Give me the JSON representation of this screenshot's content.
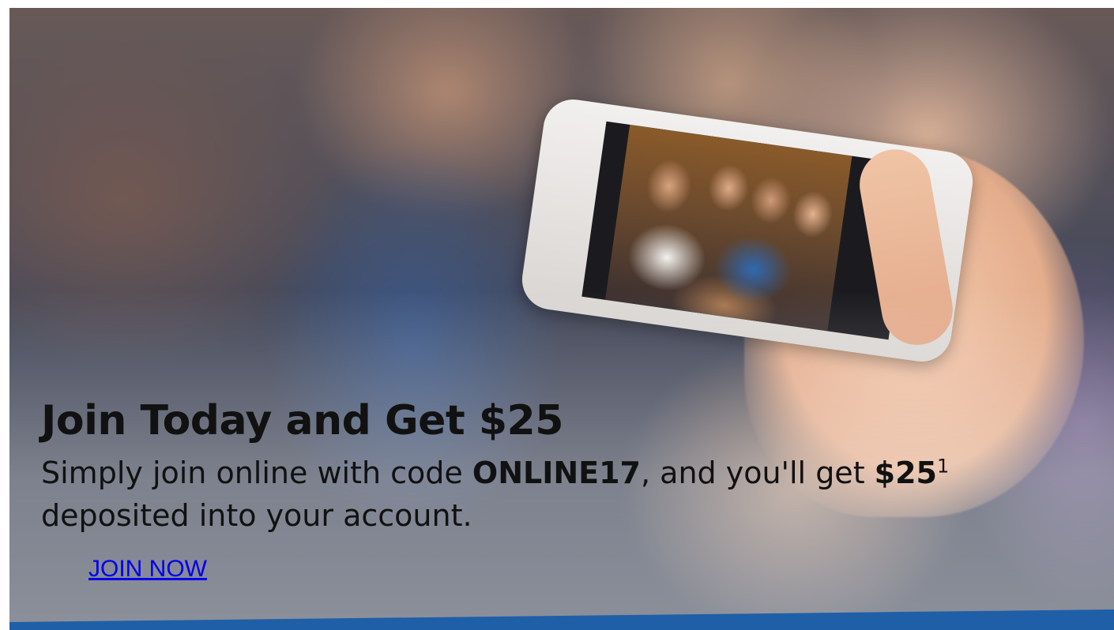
{
  "promo": {
    "headline": "Join Today and Get $25",
    "body_prefix": "Simply join online with code ",
    "code": "ONLINE17",
    "body_middle": ", and you'll get ",
    "amount": "$25",
    "footnote": "1",
    "body_suffix": " deposited into your account.",
    "cta_label": "JOIN NOW"
  },
  "colors": {
    "strip": "#1f5fa8",
    "link": "#0000ee"
  }
}
